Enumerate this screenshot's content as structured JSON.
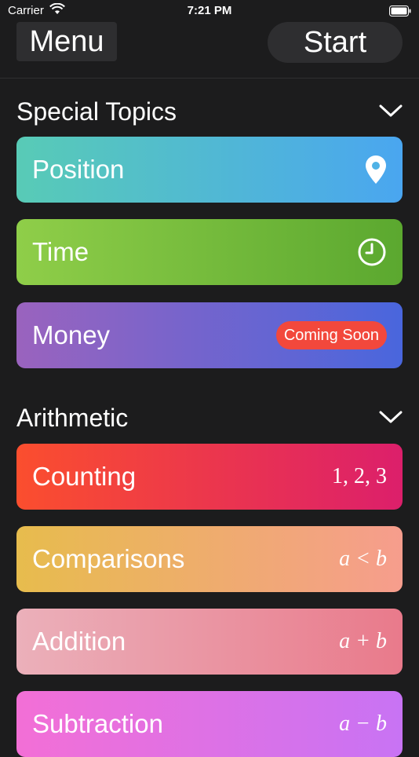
{
  "status_bar": {
    "carrier": "Carrier",
    "time": "7:21 PM"
  },
  "nav": {
    "menu_label": "Menu",
    "start_label": "Start"
  },
  "sections": [
    {
      "title": "Special Topics",
      "items": [
        {
          "label": "Position",
          "icon": "location-pin-icon"
        },
        {
          "label": "Time",
          "icon": "clock-icon"
        },
        {
          "label": "Money",
          "badge": "Coming Soon"
        }
      ]
    },
    {
      "title": "Arithmetic",
      "items": [
        {
          "label": "Counting",
          "formula": "1, 2, 3"
        },
        {
          "label": "Comparisons",
          "formula": "a < b"
        },
        {
          "label": "Addition",
          "formula": "a + b"
        },
        {
          "label": "Subtraction",
          "formula": "a − b"
        }
      ]
    }
  ],
  "colors": {
    "background": "#1c1c1d",
    "button": "#2e2e30",
    "badge": "#f2483c"
  }
}
